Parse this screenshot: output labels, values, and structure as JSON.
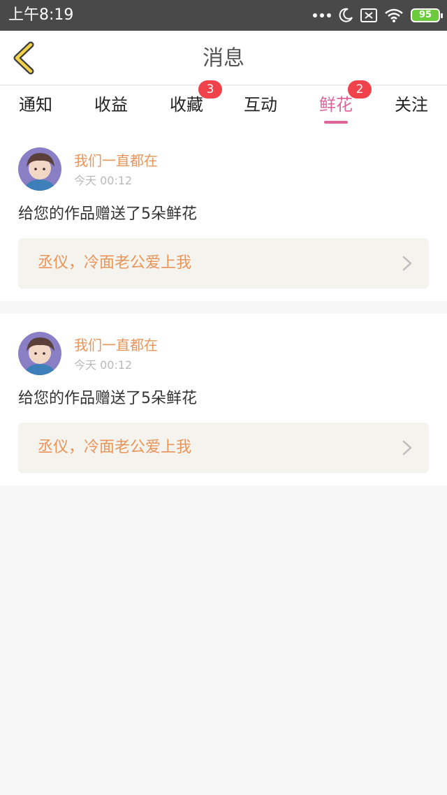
{
  "status_bar": {
    "time": "上午8:19",
    "battery_level": "95",
    "icons": [
      "more-dots-icon",
      "moon-icon",
      "sim-off-icon",
      "wifi-icon",
      "battery-icon"
    ]
  },
  "nav": {
    "title": "消息",
    "back_icon": "back-chevron-icon"
  },
  "tabs": [
    {
      "label": "通知",
      "badge": null
    },
    {
      "label": "收益",
      "badge": null
    },
    {
      "label": "收藏",
      "badge": "3"
    },
    {
      "label": "互动",
      "badge": null
    },
    {
      "label": "鲜花",
      "badge": "2",
      "active": true
    },
    {
      "label": "关注",
      "badge": null
    }
  ],
  "messages": [
    {
      "sender": "我们一直都在",
      "time": "今天 00:12",
      "text": "给您的作品赠送了5朵鲜花",
      "work_title": "丞仪，冷面老公爱上我"
    },
    {
      "sender": "我们一直都在",
      "time": "今天 00:12",
      "text": "给您的作品赠送了5朵鲜花",
      "work_title": "丞仪，冷面老公爱上我"
    }
  ],
  "colors": {
    "accent_pink": "#e0649a",
    "accent_orange": "#e9955a",
    "badge_red": "#f0424a",
    "status_bar": "#494949"
  }
}
